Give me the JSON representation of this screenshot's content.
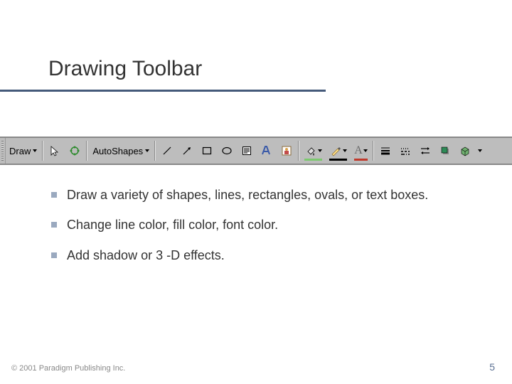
{
  "title": "Drawing Toolbar",
  "toolbar": {
    "draw_label": "Draw",
    "autoshapes_label": "AutoShapes",
    "fill_swatch": "#7cc96f",
    "line_swatch": "#000000",
    "font_swatch": "#c0392b"
  },
  "icons": {
    "select": "select-arrow-icon",
    "rotate": "free-rotate-icon",
    "line": "line-icon",
    "arrow": "arrow-icon",
    "rectangle": "rectangle-icon",
    "oval": "oval-icon",
    "textbox": "text-box-icon",
    "wordart": "wordart-icon",
    "clipart": "insert-clipart-icon",
    "fillcolor": "fill-color-icon",
    "linecolor": "line-color-icon",
    "fontcolor": "font-color-icon",
    "linestyle": "line-style-icon",
    "dashstyle": "dash-style-icon",
    "arrowstyle": "arrow-style-icon",
    "shadow": "shadow-icon",
    "threed": "3d-icon",
    "overflow": "toolbar-overflow-icon"
  },
  "bullets": [
    "Draw a variety of shapes, lines, rectangles, ovals, or text boxes.",
    "Change line color, fill color, font color.",
    "Add shadow or 3 -D effects."
  ],
  "footer": {
    "copyright": "© 2001 Paradigm Publishing Inc.",
    "page": "5"
  }
}
